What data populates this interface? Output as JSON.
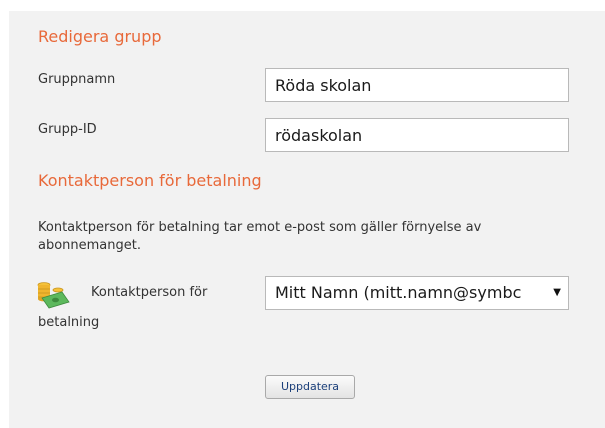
{
  "edit_group": {
    "title": "Redigera grupp",
    "group_name_label": "Gruppnamn",
    "group_name_value": "Röda skolan",
    "group_id_label": "Grupp-ID",
    "group_id_value": "rödaskolan"
  },
  "billing": {
    "title": "Kontaktperson för betalning",
    "description": "Kontaktperson för betalning tar emot e-post som gäller förnyelse av abonnemanget.",
    "contact_label_line1": "Kontaktperson för",
    "contact_label_line2": "betalning",
    "contact_selected": "Mitt Namn (mitt.namn@symbc",
    "contact_icon": "money-icon"
  },
  "actions": {
    "update_label": "Uppdatera"
  },
  "colors": {
    "heading": "#e8693a",
    "panel_bg": "#f2f2f2",
    "button_text": "#1b3f7a"
  }
}
